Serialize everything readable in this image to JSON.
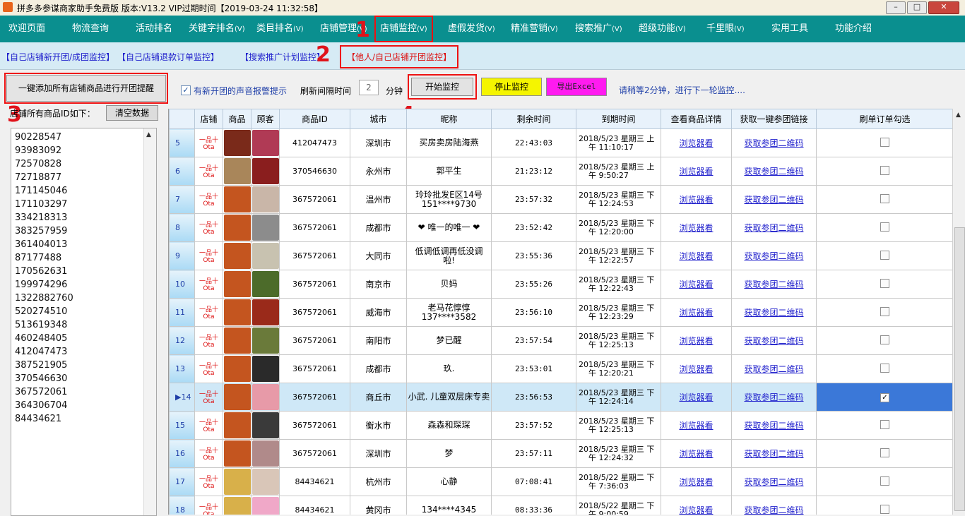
{
  "window": {
    "title": "拼多多参谋商家助手免费版 版本:V13.2 VIP过期时间【2019-03-24 11:32:58】",
    "controls": [
      "minimize",
      "maximize",
      "close"
    ]
  },
  "menu": [
    {
      "label": "欢迎页面",
      "arrow": ""
    },
    {
      "label": "物流查询",
      "arrow": ""
    },
    {
      "label": "活动排名",
      "arrow": ""
    },
    {
      "label": "关键字排名",
      "arrow": "(V)"
    },
    {
      "label": "类目排名",
      "arrow": "(V)"
    },
    {
      "label": "店铺管理",
      "arrow": "(V)"
    },
    {
      "label": "店铺监控",
      "arrow": "(V)"
    },
    {
      "label": "虚假发货",
      "arrow": "(V)"
    },
    {
      "label": "精准营销",
      "arrow": "(V)"
    },
    {
      "label": "搜索推广",
      "arrow": "(V)"
    },
    {
      "label": "超级功能",
      "arrow": "(V)"
    },
    {
      "label": "千里眼",
      "arrow": "(V)"
    },
    {
      "label": "实用工具",
      "arrow": ""
    },
    {
      "label": "功能介绍",
      "arrow": ""
    }
  ],
  "submenu": [
    "【自己店铺新开团/成团监控】",
    "【自己店铺退款订单监控】",
    "【搜索推广计划监控】",
    "【他人/自己店铺开团监控】"
  ],
  "callouts": [
    "1",
    "2",
    "3",
    "4"
  ],
  "left": {
    "add_all_button": "一键添加所有店铺商品进行开团提醒",
    "ids_label": "店铺所有商品ID如下：",
    "clear_button": "清空数据",
    "ids": [
      "90228547",
      "93983092",
      "72570828",
      "72718877",
      "171145046",
      "171103297",
      "334218313",
      "383257959",
      "361404013",
      "87177488",
      "170562631",
      "199974296",
      "1322882760",
      "520274510",
      "513619348",
      "460248405",
      "412047473",
      "387521905",
      "370546630",
      "367572061",
      "364306704",
      "84434621"
    ]
  },
  "controls": {
    "sound_checked": true,
    "sound_label": "有新开团的声音报警提示",
    "interval_label": "刷新间隔时间",
    "interval_value": "2",
    "minute_label": "分钟",
    "start_button": "开始监控",
    "stop_button": "停止监控",
    "export_button": "导出Excel",
    "wait_text": "请稍等2分钟，进行下一轮监控...."
  },
  "table": {
    "headers": [
      "",
      "店铺",
      "商品",
      "顾客",
      "商品ID",
      "城市",
      "昵称",
      "剩余时间",
      "到期时间",
      "查看商品详情",
      "获取一键参团链接",
      "刷单订单勾选"
    ],
    "shop_label": "一品十Ota",
    "view_link": "浏览器看",
    "join_link": "获取参团二维码",
    "rows": [
      {
        "idx": "5",
        "goods_id": "412047473",
        "city": "深圳市",
        "nick": "买房卖房陆海燕",
        "nick2": "",
        "left": "22:43:03",
        "exp1": "2018/5/23 星期三 上",
        "exp2": "午 11:10:17",
        "checked": false,
        "selected": false,
        "goods_color": "#7a2a1a",
        "avatar_color": "#b03a55"
      },
      {
        "idx": "6",
        "goods_id": "370546630",
        "city": "永州市",
        "nick": "郭平生",
        "nick2": "",
        "left": "21:23:12",
        "exp1": "2018/5/23 星期三 上",
        "exp2": "午 9:50:27",
        "checked": false,
        "selected": false,
        "goods_color": "#a9865a",
        "avatar_color": "#8a1e1e"
      },
      {
        "idx": "7",
        "goods_id": "367572061",
        "city": "温州市",
        "nick": "玲玲批发E区14号",
        "nick2": "151****9730",
        "left": "23:57:32",
        "exp1": "2018/5/23 星期三 下",
        "exp2": "午 12:24:53",
        "checked": false,
        "selected": false,
        "goods_color": "#c4551f",
        "avatar_color": "#c9b6a8"
      },
      {
        "idx": "8",
        "goods_id": "367572061",
        "city": "成都市",
        "nick": "❤ 唯一的唯一 ❤",
        "nick2": "",
        "left": "23:52:42",
        "exp1": "2018/5/23 星期三 下",
        "exp2": "午 12:20:00",
        "checked": false,
        "selected": false,
        "goods_color": "#c4551f",
        "avatar_color": "#8c8c8c"
      },
      {
        "idx": "9",
        "goods_id": "367572061",
        "city": "大同市",
        "nick": "低调低调再低没调",
        "nick2": "啦!",
        "left": "23:55:36",
        "exp1": "2018/5/23 星期三 下",
        "exp2": "午 12:22:57",
        "checked": false,
        "selected": false,
        "goods_color": "#c4551f",
        "avatar_color": "#c8c2b0"
      },
      {
        "idx": "10",
        "goods_id": "367572061",
        "city": "南京市",
        "nick": "贝妈",
        "nick2": "",
        "left": "23:55:26",
        "exp1": "2018/5/23 星期三 下",
        "exp2": "午 12:22:43",
        "checked": false,
        "selected": false,
        "goods_color": "#c4551f",
        "avatar_color": "#4c6b2a"
      },
      {
        "idx": "11",
        "goods_id": "367572061",
        "city": "威海市",
        "nick": "老马花惇惇",
        "nick2": "137****3582",
        "left": "23:56:10",
        "exp1": "2018/5/23 星期三 下",
        "exp2": "午 12:23:29",
        "checked": false,
        "selected": false,
        "goods_color": "#c4551f",
        "avatar_color": "#9a2a1a"
      },
      {
        "idx": "12",
        "goods_id": "367572061",
        "city": "南阳市",
        "nick": "梦已醒",
        "nick2": "",
        "left": "23:57:54",
        "exp1": "2018/5/23 星期三 下",
        "exp2": "午 12:25:13",
        "checked": false,
        "selected": false,
        "goods_color": "#c4551f",
        "avatar_color": "#6a7a3a"
      },
      {
        "idx": "13",
        "goods_id": "367572061",
        "city": "成都市",
        "nick": "玖.",
        "nick2": "",
        "left": "23:53:01",
        "exp1": "2018/5/23 星期三 下",
        "exp2": "午 12:20:21",
        "checked": false,
        "selected": false,
        "goods_color": "#c4551f",
        "avatar_color": "#2a2a2a"
      },
      {
        "idx": "▶14",
        "goods_id": "367572061",
        "city": "商丘市",
        "nick": "小武. 儿童双层床专卖",
        "nick2": "",
        "left": "23:56:53",
        "exp1": "2018/5/23 星期三 下",
        "exp2": "午 12:24:14",
        "checked": true,
        "selected": true,
        "goods_color": "#c4551f",
        "avatar_color": "#e79aa8"
      },
      {
        "idx": "15",
        "goods_id": "367572061",
        "city": "衡水市",
        "nick": "森森和琛琛",
        "nick2": "",
        "left": "23:57:52",
        "exp1": "2018/5/23 星期三 下",
        "exp2": "午 12:25:13",
        "checked": false,
        "selected": false,
        "goods_color": "#c4551f",
        "avatar_color": "#3a3a3a"
      },
      {
        "idx": "16",
        "goods_id": "367572061",
        "city": "深圳市",
        "nick": "梦",
        "nick2": "",
        "left": "23:57:11",
        "exp1": "2018/5/23 星期三 下",
        "exp2": "午 12:24:32",
        "checked": false,
        "selected": false,
        "goods_color": "#c4551f",
        "avatar_color": "#b08a8a"
      },
      {
        "idx": "17",
        "goods_id": "84434621",
        "city": "杭州市",
        "nick": "心静",
        "nick2": "",
        "left": "07:08:41",
        "exp1": "2018/5/22 星期二 下",
        "exp2": "午 7:36:03",
        "checked": false,
        "selected": false,
        "goods_color": "#d8b04a",
        "avatar_color": "#d9c6b8"
      },
      {
        "idx": "18",
        "goods_id": "84434621",
        "city": "黄冈市",
        "nick": "134****4345",
        "nick2": "",
        "left": "08:33:36",
        "exp1": "2018/5/22 星期二 下",
        "exp2": "午 9:00:59",
        "checked": false,
        "selected": false,
        "goods_color": "#d8b04a",
        "avatar_color": "#f0a8c8"
      }
    ]
  }
}
